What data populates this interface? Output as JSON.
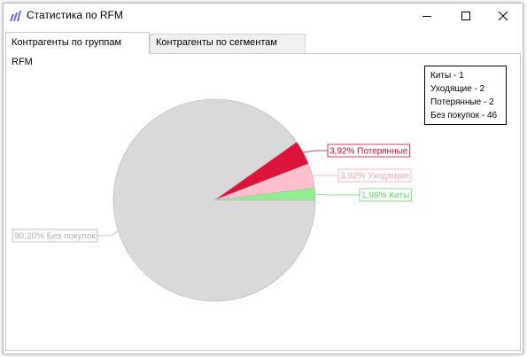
{
  "window": {
    "title": "Статистика по RFM",
    "icon": "bar-chart-icon",
    "controls": {
      "minimize": "minimize-icon",
      "maximize": "maximize-icon",
      "close": "close-icon"
    }
  },
  "tabs": [
    {
      "label": "Контрагенты по группам RFM",
      "active": true
    },
    {
      "label": "Контрагенты по сегментам RFM",
      "active": false
    }
  ],
  "legend": {
    "items": [
      "Киты - 1",
      "Уходящие - 2",
      "Потерянные - 2",
      "Без покупок - 46"
    ]
  },
  "chart_data": {
    "type": "pie",
    "slices": [
      {
        "label": "1,96% Киты",
        "value": 1.96,
        "color": "#90ee90",
        "label_color": "#6fcf6f"
      },
      {
        "label": "3,92% Уходящие",
        "value": 3.92,
        "color": "#ffc0cb",
        "label_color": "#f4a7b4"
      },
      {
        "label": "3,92% Потерянные",
        "value": 3.92,
        "color": "#dc143c",
        "label_color": "#c0143c"
      },
      {
        "label": "90,20% Без покупок",
        "value": 90.2,
        "color": "#d9d9d9",
        "label_color": "#b0b0b0"
      }
    ]
  }
}
